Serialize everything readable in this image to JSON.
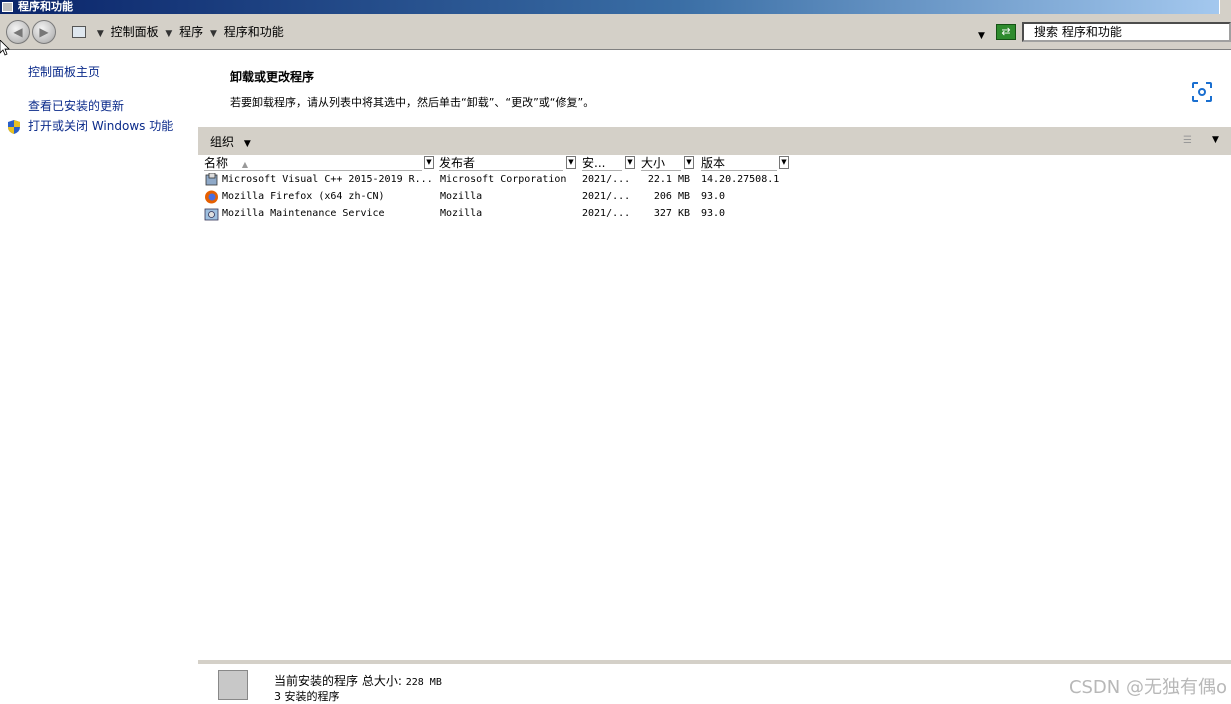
{
  "window": {
    "title": "程序和功能"
  },
  "address": {
    "crumbs": [
      "控制面板",
      "程序",
      "程序和功能"
    ],
    "search_placeholder": "搜索 程序和功能"
  },
  "sidebar": {
    "home": "控制面板主页",
    "updates": "查看已安装的更新",
    "features": "打开或关闭 Windows 功能"
  },
  "main": {
    "heading": "卸载或更改程序",
    "description": "若要卸载程序，请从列表中将其选中，然后单击“卸载”、“更改”或“修复”。"
  },
  "toolbar": {
    "organize": "组织"
  },
  "columns": {
    "name": "名称",
    "publisher": "发布者",
    "installed": "安...",
    "size": "大小",
    "version": "版本"
  },
  "programs": [
    {
      "name": "Microsoft Visual C++ 2015-2019 R...",
      "publisher": "Microsoft Corporation",
      "installed": "2021/...",
      "size": "22.1 MB",
      "version": "14.20.27508.1",
      "icon": "installer-icon"
    },
    {
      "name": "Mozilla Firefox (x64 zh-CN)",
      "publisher": "Mozilla",
      "installed": "2021/...",
      "size": "206 MB",
      "version": "93.0",
      "icon": "firefox-icon"
    },
    {
      "name": "Mozilla Maintenance Service",
      "publisher": "Mozilla",
      "installed": "2021/...",
      "size": "327 KB",
      "version": "93.0",
      "icon": "maintenance-service-icon"
    }
  ],
  "footer": {
    "current_label": "当前安装的程序",
    "total_label": "总大小:",
    "total_value": "228 MB",
    "count": "3 安装的程序"
  },
  "watermark": "CSDN @无独有偶o"
}
